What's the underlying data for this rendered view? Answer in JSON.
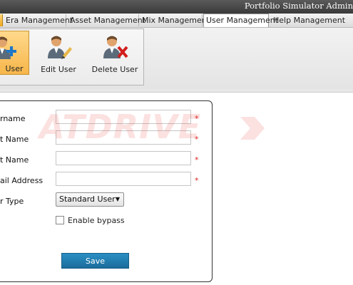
{
  "window": {
    "title": "Portfolio Simulator Admin"
  },
  "tabs": [
    {
      "label": "Era Management"
    },
    {
      "label": "Asset Management"
    },
    {
      "label": "Mix Management"
    },
    {
      "label": "User Management",
      "active": true
    },
    {
      "label": "Help Management"
    }
  ],
  "ribbon": {
    "add_user_label": "User",
    "edit_user_label": "Edit User",
    "delete_user_label": "Delete User"
  },
  "form": {
    "username_label": "rname",
    "firstname_label": "t Name",
    "lastname_label": "t Name",
    "email_label": "ail Address",
    "usertype_label": "r Type",
    "required_mark": "*",
    "user_type_value": "Standard User",
    "bypass_label": "Enable bypass",
    "bypass_checked": false,
    "save_label": "Save"
  },
  "watermark": {
    "text": "ATDRIVE"
  },
  "colors": {
    "save_button": "#1d76a8",
    "active_button": "#f7b64a",
    "required": "#dd2222"
  }
}
